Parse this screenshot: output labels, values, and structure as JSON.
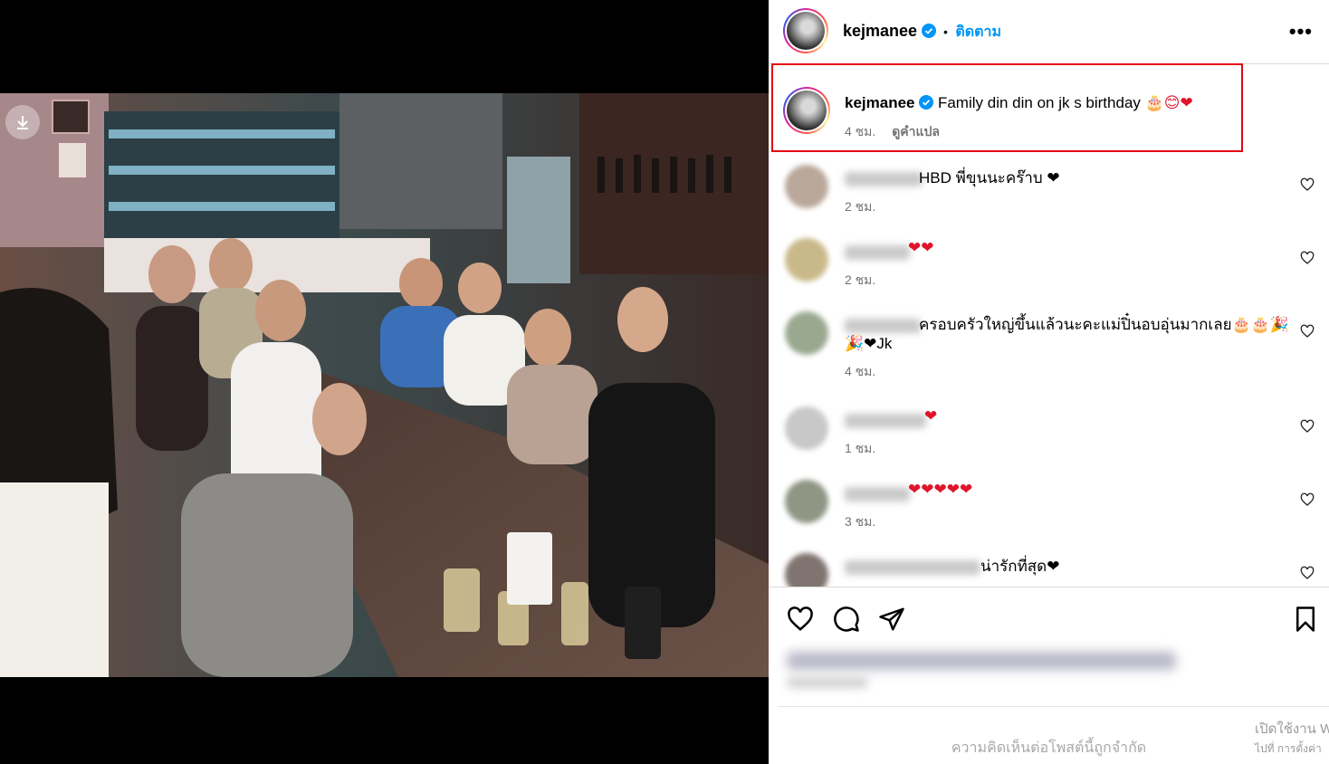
{
  "post": {
    "username": "kejmanee",
    "follow_label": "ติดตาม",
    "dot": "•",
    "more": "•••",
    "caption": "Family din din on jk s birthday",
    "caption_emoji": "🎂😊❤",
    "caption_time": "4 ชม.",
    "translate_label": "ดูคำแปล"
  },
  "comments": [
    {
      "text": "HBD พี่ขุนนะคร๊าบ ❤",
      "time": "2 ชม.",
      "avatar_color": "#b9a79a",
      "name_width": 86
    },
    {
      "text": "❤❤",
      "time": "2 ชม.",
      "avatar_color": "#c9b98a",
      "name_width": 72
    },
    {
      "text": "ครอบครัวใหญ่ขึ้นแล้วนะคะแม่ปิ๋นอบอุ่นมากเลย🎂🎂🎉",
      "text2": "🎉❤Jk",
      "time": "4 ชม.",
      "avatar_color": "#9aa890",
      "name_width": 84
    },
    {
      "text": "❤",
      "time": "1 ชม.",
      "avatar_color": "#c8c8c8",
      "name_width": 90
    },
    {
      "text": "❤❤❤❤❤",
      "time": "3 ชม.",
      "avatar_color": "#8f9684",
      "name_width": 72
    },
    {
      "text": "น่ารักที่สุด❤",
      "time": "",
      "avatar_color": "#7f7470",
      "name_width": 150
    }
  ],
  "footer": {
    "restricted": "ความคิดเห็นต่อโพสต์นี้ถูกจำกัด",
    "activate_line1": "เปิดใช้งาน Windows",
    "activate_line2": "ไปที่ การตั้งค่า"
  },
  "colors": {
    "accent": "#0095f6",
    "heart": "#e0142a",
    "highlight": "#e30613"
  },
  "icons": [
    "download-icon",
    "verified-icon",
    "more-icon",
    "heart-icon",
    "comment-icon",
    "share-icon",
    "bookmark-icon"
  ]
}
